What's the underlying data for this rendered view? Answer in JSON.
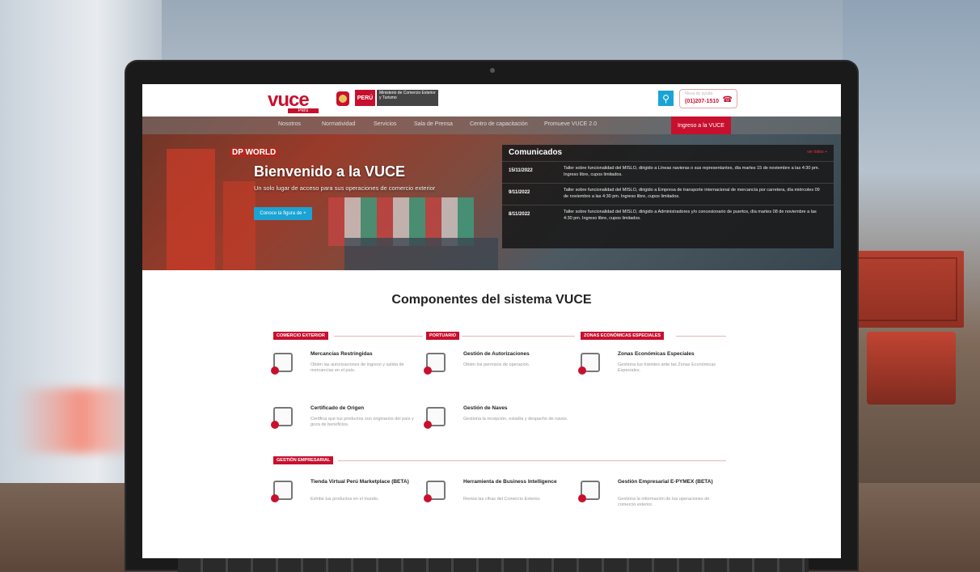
{
  "topbar": {
    "logo": "vuce",
    "logo_sub": "Perú",
    "peru": "PERÚ",
    "ministry": "Ministerio de Comercio Exterior y Turismo",
    "phone_label": "Mesa de ayuda",
    "phone": "(01)207-1510"
  },
  "nav": {
    "items": [
      "Nosotros",
      "Normatividad",
      "Servicios",
      "Sala de Prensa",
      "Centro de capacitación",
      "Promueve VUCE 2.0"
    ],
    "login": "Ingreso a la VUCE"
  },
  "hero": {
    "dp_world": "DP WORLD",
    "title": "Bienvenido a la VUCE",
    "subtitle": "Un solo lugar de acceso para sus operaciones de comercio exterior",
    "button": "Conoce la figura de +"
  },
  "comunicados": {
    "title": "Comunicados",
    "more": "ver todos +",
    "items": [
      {
        "date": "15/11/2022",
        "text": "Taller sobre funcionalidad del MISLO, dirigido a Líneas navieras o sus representantes, día martes 15 de noviembre a las 4:30 pm. Ingreso libre, cupos limitados."
      },
      {
        "date": "9/11/2022",
        "text": "Taller sobre funcionalidad del MISLO, dirigido a Empresa de transporte internacional de mercancía por carretera, día miércoles 09 de noviembre a las 4:30 pm. Ingreso libre, cupos limitados."
      },
      {
        "date": "8/11/2022",
        "text": "Taller sobre funcionalidad del MISLO, dirigido a Administradores y/o concesionario de puertos, día martes 08 de noviembre a las 4:30 pm. Ingreso libre, cupos limitados."
      }
    ]
  },
  "components": {
    "title": "Componentes del sistema VUCE",
    "categories": {
      "comercio": "COMERCIO EXTERIOR",
      "portuario": "PORTUARIO",
      "zonas": "ZONAS ECONÓMICAS ESPECIALES",
      "gestion": "GESTIÓN EMPRESARIAL"
    },
    "items": {
      "mercancias": {
        "title": "Mercancías Restringidas",
        "desc": "Obtén las autorizaciones de ingreso y salida de mercancías en el país."
      },
      "autorizaciones": {
        "title": "Gestión de Autorizaciones",
        "desc": "Obtén los permisos de operación."
      },
      "zonas": {
        "title": "Zonas Económicas Especiales",
        "desc": "Gestiona tus trámites ante las Zonas Económicas Especiales."
      },
      "certificado": {
        "title": "Certificado de Origen",
        "desc": "Certifica que tus productos son originarios del país y goza de beneficios."
      },
      "naves": {
        "title": "Gestión de Naves",
        "desc": "Gestiona la recepción, estadía y despacho de naves."
      },
      "tienda": {
        "title": "Tienda Virtual Perú Marketplace (BETA)",
        "desc": "Exhibe tus productos en el mundo."
      },
      "bi": {
        "title": "Herramienta de Business Intelligence",
        "desc": "Revisa las cifras del Comercio Exterior."
      },
      "pymex": {
        "title": "Gestión Empresarial E-PYMEX (BETA)",
        "desc": "Gestiona la información de tus operaciones de comercio exterior."
      }
    }
  }
}
